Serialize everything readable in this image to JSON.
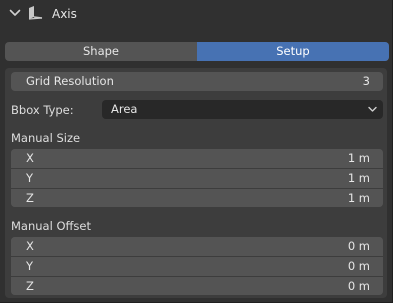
{
  "panel": {
    "title": "Axis"
  },
  "tabs": [
    {
      "label": "Shape",
      "active": false
    },
    {
      "label": "Setup",
      "active": true
    }
  ],
  "grid_resolution": {
    "label": "Grid Resolution",
    "value": "3"
  },
  "bbox_type": {
    "label": "Bbox Type:",
    "value": "Area"
  },
  "manual_size": {
    "label": "Manual Size",
    "rows": [
      {
        "axis": "X",
        "value": "1 m"
      },
      {
        "axis": "Y",
        "value": "1 m"
      },
      {
        "axis": "Z",
        "value": "1 m"
      }
    ]
  },
  "manual_offset": {
    "label": "Manual Offset",
    "rows": [
      {
        "axis": "X",
        "value": "0 m"
      },
      {
        "axis": "Y",
        "value": "0 m"
      },
      {
        "axis": "Z",
        "value": "0 m"
      }
    ]
  },
  "colors": {
    "background": "#303030",
    "accent": "#4772b3",
    "field": "#545454",
    "dropdown": "#282828"
  },
  "icons": {
    "collapse": "chevron-down-icon",
    "panel": "axis-icon",
    "dropdown": "chevron-down-icon"
  }
}
